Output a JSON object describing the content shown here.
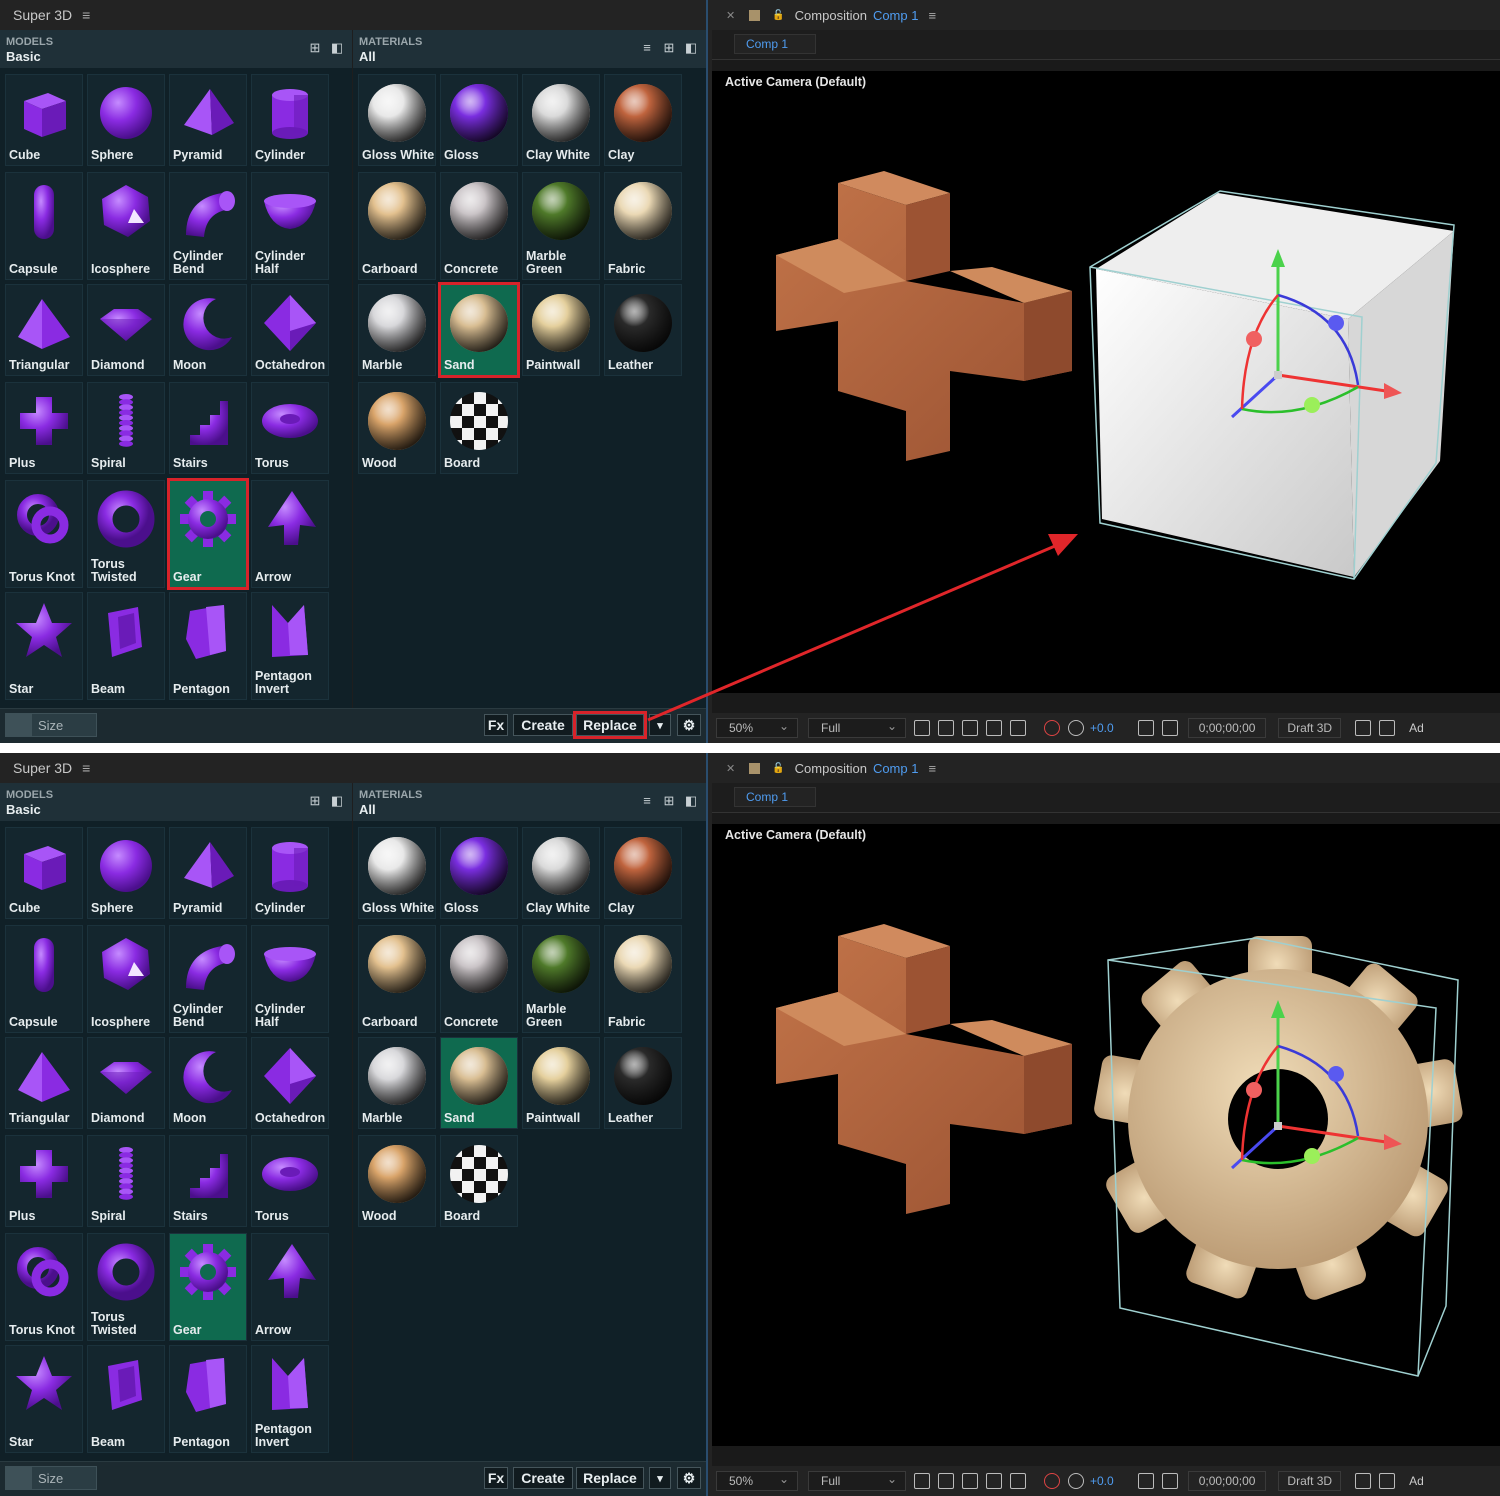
{
  "panels": [
    {
      "id": "top",
      "app_tab": "Super 3D",
      "models_header": {
        "key": "MODELS",
        "value": "Basic"
      },
      "materials_header": {
        "key": "MATERIALS",
        "value": "All"
      },
      "models": [
        {
          "label": "Cube",
          "shape": "cube"
        },
        {
          "label": "Sphere",
          "shape": "sphere"
        },
        {
          "label": "Pyramid",
          "shape": "pyramid"
        },
        {
          "label": "Cylinder",
          "shape": "cylinder"
        },
        {
          "label": "Capsule",
          "shape": "capsule"
        },
        {
          "label": "Icosphere",
          "shape": "icosphere"
        },
        {
          "label": "Cylinder\nBend",
          "shape": "bend"
        },
        {
          "label": "Cylinder\nHalf",
          "shape": "half"
        },
        {
          "label": "Triangular",
          "shape": "triangular"
        },
        {
          "label": "Diamond",
          "shape": "diamond"
        },
        {
          "label": "Moon",
          "shape": "moon"
        },
        {
          "label": "Octahedron",
          "shape": "octa"
        },
        {
          "label": "Plus",
          "shape": "plus"
        },
        {
          "label": "Spiral",
          "shape": "spiral"
        },
        {
          "label": "Stairs",
          "shape": "stairs"
        },
        {
          "label": "Torus",
          "shape": "torus"
        },
        {
          "label": "Torus Knot",
          "shape": "knot"
        },
        {
          "label": "Torus\nTwisted",
          "shape": "ring"
        },
        {
          "label": "Gear",
          "shape": "gear",
          "selected": true,
          "highlight": true
        },
        {
          "label": "Arrow",
          "shape": "arrow"
        },
        {
          "label": "Star",
          "shape": "star"
        },
        {
          "label": "Beam",
          "shape": "beam"
        },
        {
          "label": "Pentagon",
          "shape": "pentagon"
        },
        {
          "label": "Pentagon\nInvert",
          "shape": "pentinv"
        }
      ],
      "materials": [
        {
          "label": "Gloss White",
          "color": "#e8e8e8"
        },
        {
          "label": "Gloss",
          "color": "#7a2ee0"
        },
        {
          "label": "Clay White",
          "color": "#d9d9d9"
        },
        {
          "label": "Clay",
          "color": "#c0643e"
        },
        {
          "label": "Carboard",
          "color": "#e2c08e"
        },
        {
          "label": "Concrete",
          "color": "#c9c3c6"
        },
        {
          "label": "Marble\nGreen",
          "color": "#4f7a2a"
        },
        {
          "label": "Fabric",
          "color": "#ead8b4"
        },
        {
          "label": "Marble",
          "color": "#d7d7da"
        },
        {
          "label": "Sand",
          "color": "#d8bd92",
          "selected": true,
          "highlight": true
        },
        {
          "label": "Paintwall",
          "color": "#e4cf9c"
        },
        {
          "label": "Leather",
          "color": "#2a2a2a"
        },
        {
          "label": "Wood",
          "color": "#d9a46a"
        },
        {
          "label": "Board",
          "color": "checker"
        }
      ],
      "footer": {
        "size_label": "Size",
        "fx_label": "Fx",
        "create_label": "Create",
        "replace_label": "Replace",
        "replace_highlight": true
      },
      "ae": {
        "window_title": "Composition",
        "comp_name": "Comp 1",
        "comp_tab": "Comp 1",
        "viewport_label": "Active Camera (Default)",
        "zoom": "50%",
        "resolution": "Full",
        "exposure": "+0.0",
        "timecode": "0;00;00;00",
        "renderer": "Draft 3D",
        "overflow_text": "Ad"
      },
      "object": "cube"
    },
    {
      "id": "bot",
      "app_tab": "Super 3D",
      "models_header": {
        "key": "MODELS",
        "value": "Basic"
      },
      "materials_header": {
        "key": "MATERIALS",
        "value": "All"
      },
      "models": [
        {
          "label": "Cube",
          "shape": "cube"
        },
        {
          "label": "Sphere",
          "shape": "sphere"
        },
        {
          "label": "Pyramid",
          "shape": "pyramid"
        },
        {
          "label": "Cylinder",
          "shape": "cylinder"
        },
        {
          "label": "Capsule",
          "shape": "capsule"
        },
        {
          "label": "Icosphere",
          "shape": "icosphere"
        },
        {
          "label": "Cylinder\nBend",
          "shape": "bend"
        },
        {
          "label": "Cylinder\nHalf",
          "shape": "half"
        },
        {
          "label": "Triangular",
          "shape": "triangular"
        },
        {
          "label": "Diamond",
          "shape": "diamond"
        },
        {
          "label": "Moon",
          "shape": "moon"
        },
        {
          "label": "Octahedron",
          "shape": "octa"
        },
        {
          "label": "Plus",
          "shape": "plus"
        },
        {
          "label": "Spiral",
          "shape": "spiral"
        },
        {
          "label": "Stairs",
          "shape": "stairs"
        },
        {
          "label": "Torus",
          "shape": "torus"
        },
        {
          "label": "Torus Knot",
          "shape": "knot"
        },
        {
          "label": "Torus\nTwisted",
          "shape": "ring"
        },
        {
          "label": "Gear",
          "shape": "gear",
          "selected": true
        },
        {
          "label": "Arrow",
          "shape": "arrow"
        },
        {
          "label": "Star",
          "shape": "star"
        },
        {
          "label": "Beam",
          "shape": "beam"
        },
        {
          "label": "Pentagon",
          "shape": "pentagon"
        },
        {
          "label": "Pentagon\nInvert",
          "shape": "pentinv"
        }
      ],
      "materials": [
        {
          "label": "Gloss White",
          "color": "#e8e8e8"
        },
        {
          "label": "Gloss",
          "color": "#7a2ee0"
        },
        {
          "label": "Clay White",
          "color": "#d9d9d9"
        },
        {
          "label": "Clay",
          "color": "#c0643e"
        },
        {
          "label": "Carboard",
          "color": "#e2c08e"
        },
        {
          "label": "Concrete",
          "color": "#c9c3c6"
        },
        {
          "label": "Marble\nGreen",
          "color": "#4f7a2a"
        },
        {
          "label": "Fabric",
          "color": "#ead8b4"
        },
        {
          "label": "Marble",
          "color": "#d7d7da"
        },
        {
          "label": "Sand",
          "color": "#d8bd92",
          "selected": true
        },
        {
          "label": "Paintwall",
          "color": "#e4cf9c"
        },
        {
          "label": "Leather",
          "color": "#2a2a2a"
        },
        {
          "label": "Wood",
          "color": "#d9a46a"
        },
        {
          "label": "Board",
          "color": "checker"
        }
      ],
      "footer": {
        "size_label": "Size",
        "fx_label": "Fx",
        "create_label": "Create",
        "replace_label": "Replace",
        "replace_highlight": false
      },
      "ae": {
        "window_title": "Composition",
        "comp_name": "Comp 1",
        "comp_tab": "Comp 1",
        "viewport_label": "Active Camera (Default)",
        "zoom": "50%",
        "resolution": "Full",
        "exposure": "+0.0",
        "timecode": "0;00;00;00",
        "renderer": "Draft 3D",
        "overflow_text": "Ad"
      },
      "object": "gear"
    }
  ],
  "colors": {
    "model_purple": "#8a2be2",
    "selected_tile": "#0f6a4f",
    "highlight_red": "#d8232a",
    "ae_accent": "#4f9cf0",
    "plus_clay": "#b5663f",
    "cube_white": "#f0f0f0",
    "gear_sand": "#d9bf95"
  }
}
